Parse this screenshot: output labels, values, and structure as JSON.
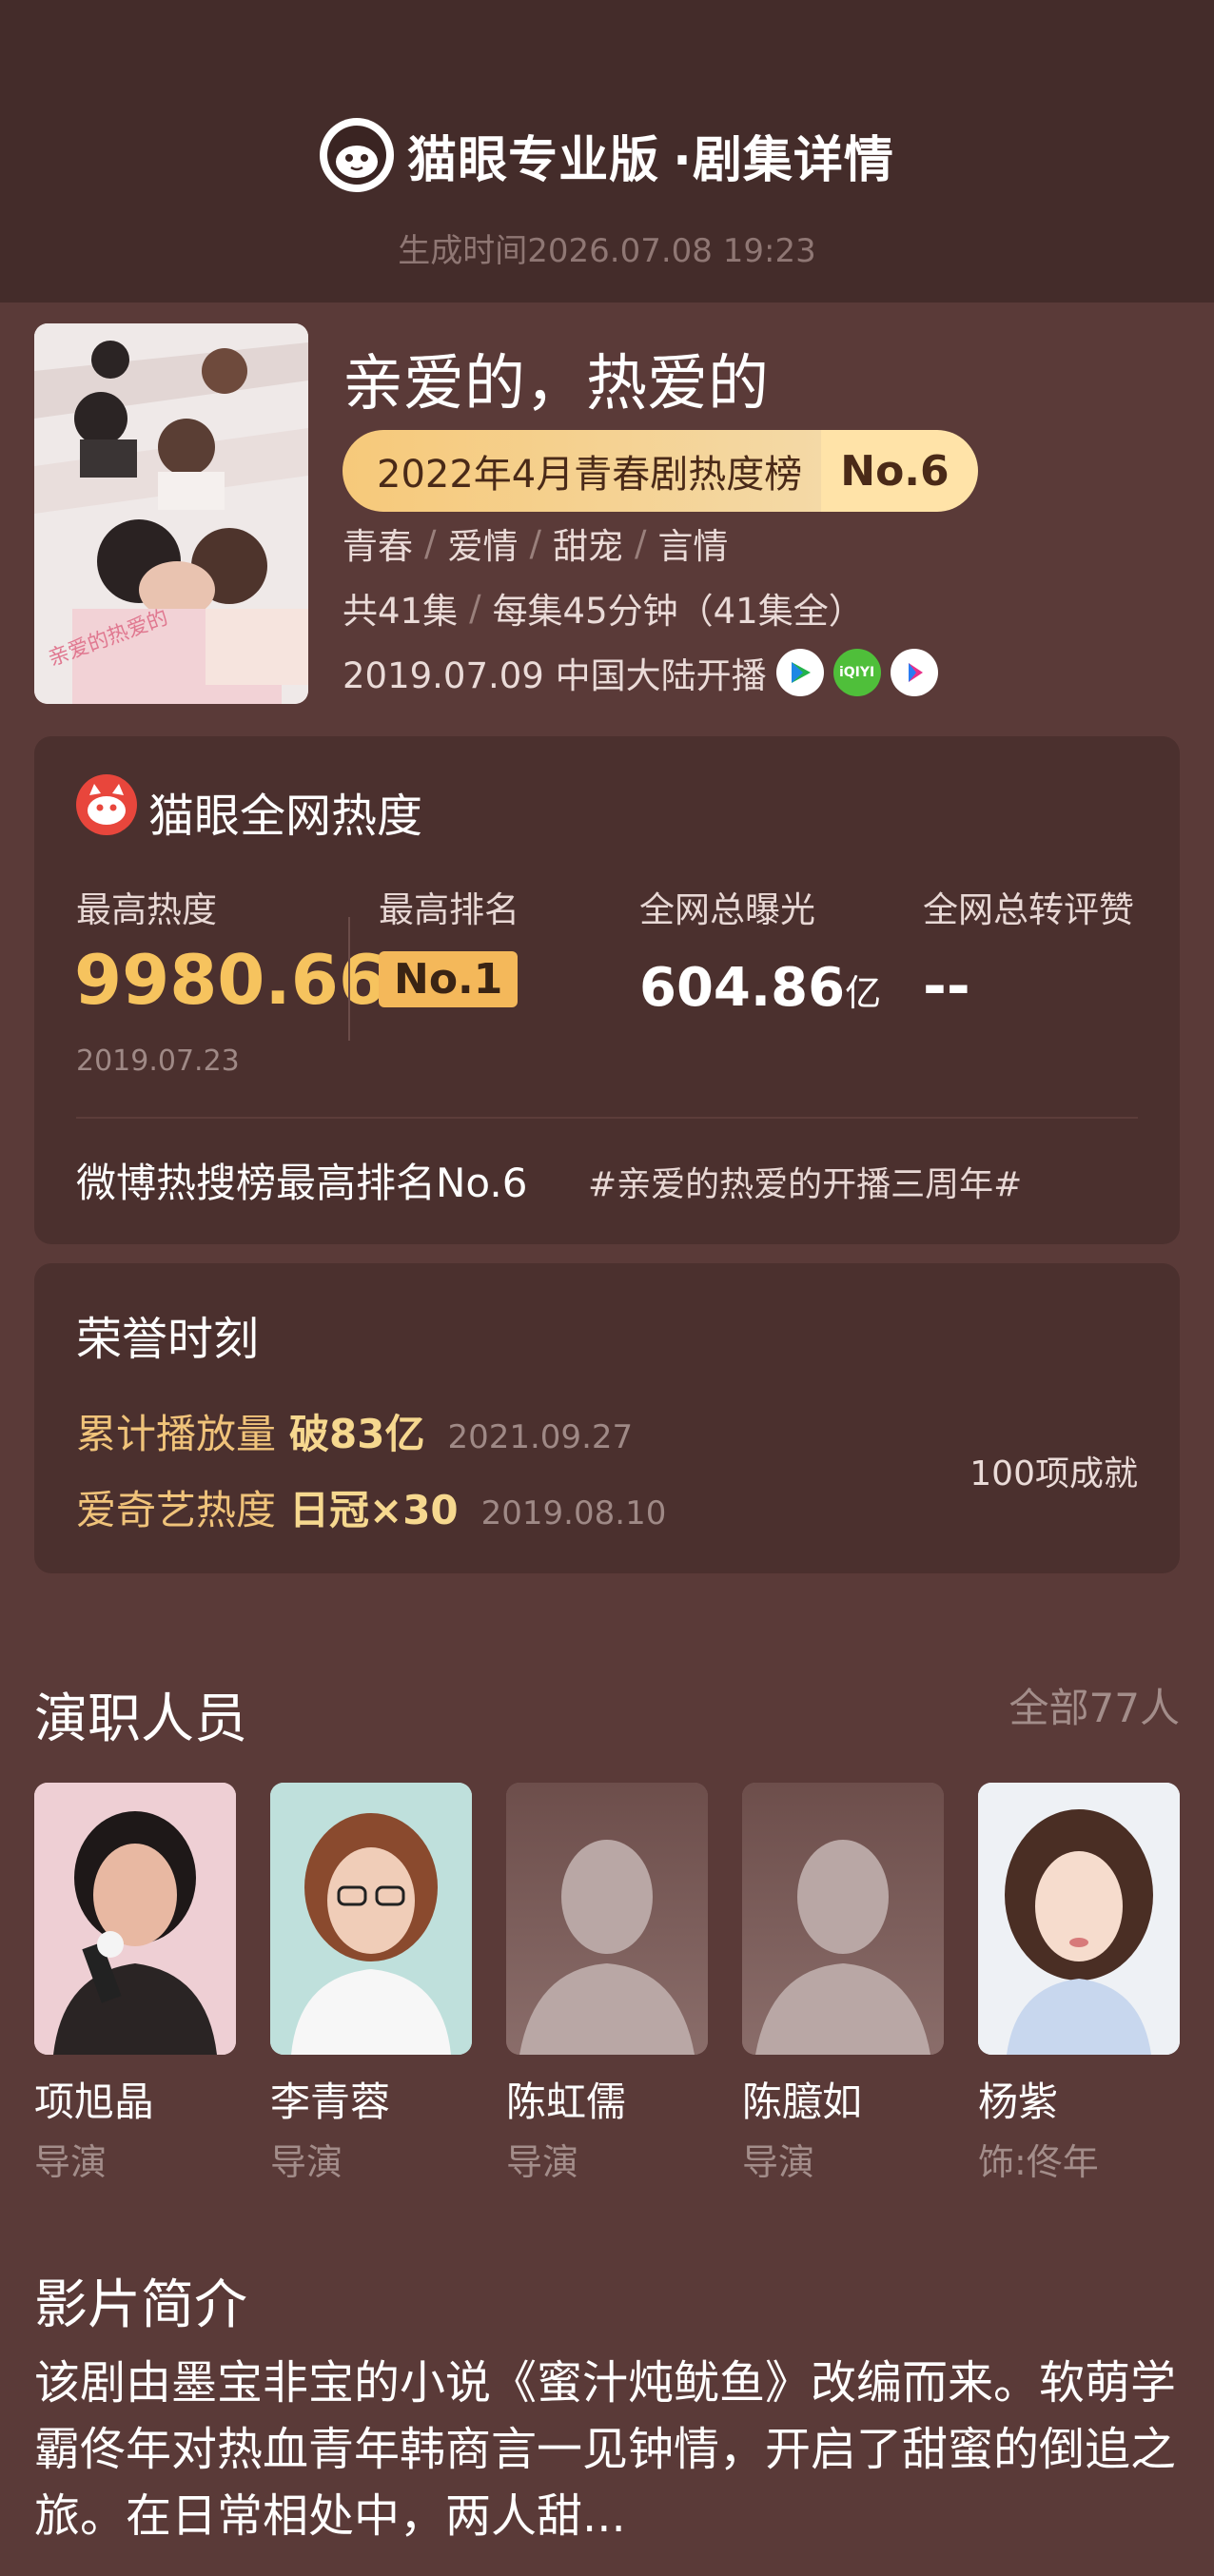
{
  "header": {
    "brand": "猫眼专业版",
    "subtitle": "·剧集详情",
    "generated_time": "生成时间2026.07.08 19:23"
  },
  "show": {
    "title": "亲爱的，热爱的",
    "rank_label": "2022年4月青春剧热度榜",
    "rank_value": "No.6",
    "tags": [
      "青春",
      "爱情",
      "甜宠",
      "言情"
    ],
    "episodes": "共41集",
    "duration": "每集45分钟（41集全）",
    "premiere": "2019.07.09 中国大陆开播",
    "platforms": [
      "tencent-video-icon",
      "iqiyi-icon",
      "youku-icon"
    ]
  },
  "heat": {
    "title": "猫眼全网热度",
    "max_heat_label": "最高热度",
    "max_heat_value": "9980.66",
    "max_heat_date": "2019.07.23",
    "max_rank_label": "最高排名",
    "max_rank_value": "No.1",
    "exposure_label": "全网总曝光",
    "exposure_value": "604.86",
    "exposure_unit": "亿",
    "engagement_label": "全网总转评赞",
    "engagement_value": "--",
    "weibo_rank": "微博热搜榜最高排名No.6",
    "weibo_tag": "#亲爱的热爱的开播三周年#"
  },
  "honor": {
    "title": "荣誉时刻",
    "items": [
      {
        "key": "累计播放量",
        "value": "破83亿",
        "date": "2021.09.27"
      },
      {
        "key": "爱奇艺热度",
        "value": "日冠×30",
        "date": "2019.08.10"
      }
    ],
    "count": "100项成就"
  },
  "cast": {
    "title": "演职人员",
    "all": "全部77人",
    "members": [
      {
        "name": "项旭晶",
        "role": "导演"
      },
      {
        "name": "李青蓉",
        "role": "导演"
      },
      {
        "name": "陈虹儒",
        "role": "导演"
      },
      {
        "name": "陈臆如",
        "role": "导演"
      },
      {
        "name": "杨紫",
        "role": "饰:佟年"
      }
    ]
  },
  "synopsis": {
    "title": "影片简介",
    "text": "该剧由墨宝非宝的小说《蜜汁炖鱿鱼》改编而来。软萌学霸佟年对热血青年韩商言一见钟情，开启了甜蜜的倒追之旅。在日常相处中，两人甜..."
  },
  "colors": {
    "page_bg": "#5a3a38",
    "header_bg": "#442c2a",
    "card_bg": "#4b302e",
    "gold": "#f6c35e"
  }
}
